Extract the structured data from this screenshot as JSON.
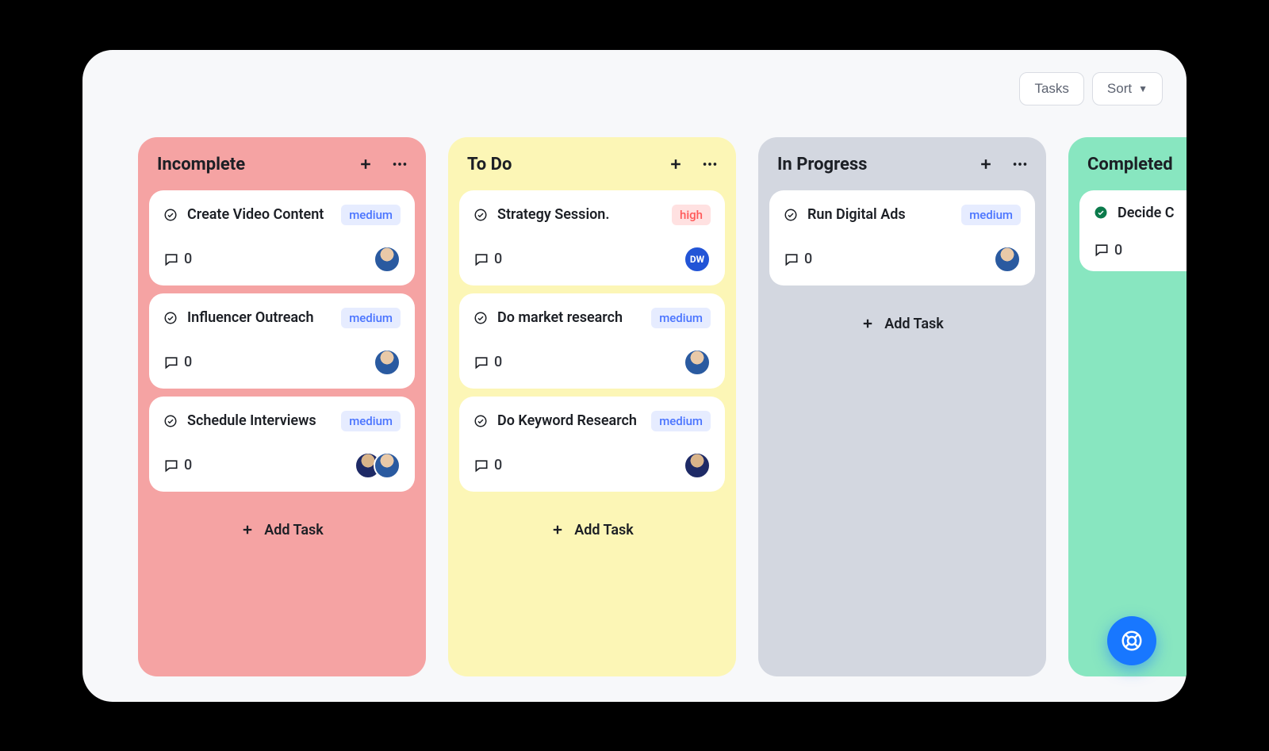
{
  "topbar": {
    "tasks_label": "Tasks",
    "sort_label": "Sort"
  },
  "add_task_label": "Add Task",
  "columns": [
    {
      "id": "incomplete",
      "class": "col-incomplete",
      "title": "Incomplete",
      "show_add_task": true,
      "cards": [
        {
          "title": "Create Video Content",
          "priority": "medium",
          "comments": 0,
          "avatars": [
            {
              "type": "photo"
            }
          ]
        },
        {
          "title": "Influencer Outreach",
          "priority": "medium",
          "comments": 0,
          "avatars": [
            {
              "type": "photo"
            }
          ]
        },
        {
          "title": "Schedule Interviews",
          "priority": "medium",
          "comments": 0,
          "avatars": [
            {
              "type": "dark"
            },
            {
              "type": "photo"
            }
          ]
        }
      ]
    },
    {
      "id": "todo",
      "class": "col-todo",
      "title": "To Do",
      "show_add_task": true,
      "cards": [
        {
          "title": "Strategy Session.",
          "priority": "high",
          "comments": 0,
          "avatars": [
            {
              "type": "initials",
              "text": "DW"
            }
          ]
        },
        {
          "title": "Do market research",
          "priority": "medium",
          "comments": 0,
          "avatars": [
            {
              "type": "photo"
            }
          ]
        },
        {
          "title": "Do Keyword Research",
          "priority": "medium",
          "comments": 0,
          "avatars": [
            {
              "type": "dark"
            }
          ]
        }
      ]
    },
    {
      "id": "inprogress",
      "class": "col-progress",
      "title": "In Progress",
      "show_add_task": true,
      "cards": [
        {
          "title": "Run Digital Ads",
          "priority": "medium",
          "comments": 0,
          "avatars": [
            {
              "type": "photo"
            }
          ]
        }
      ]
    },
    {
      "id": "completed",
      "class": "col-done",
      "title": "Completed",
      "show_add_task": false,
      "cards": [
        {
          "title": "Decide C",
          "priority": null,
          "comments": 0,
          "avatars": [],
          "done": true
        }
      ]
    }
  ]
}
